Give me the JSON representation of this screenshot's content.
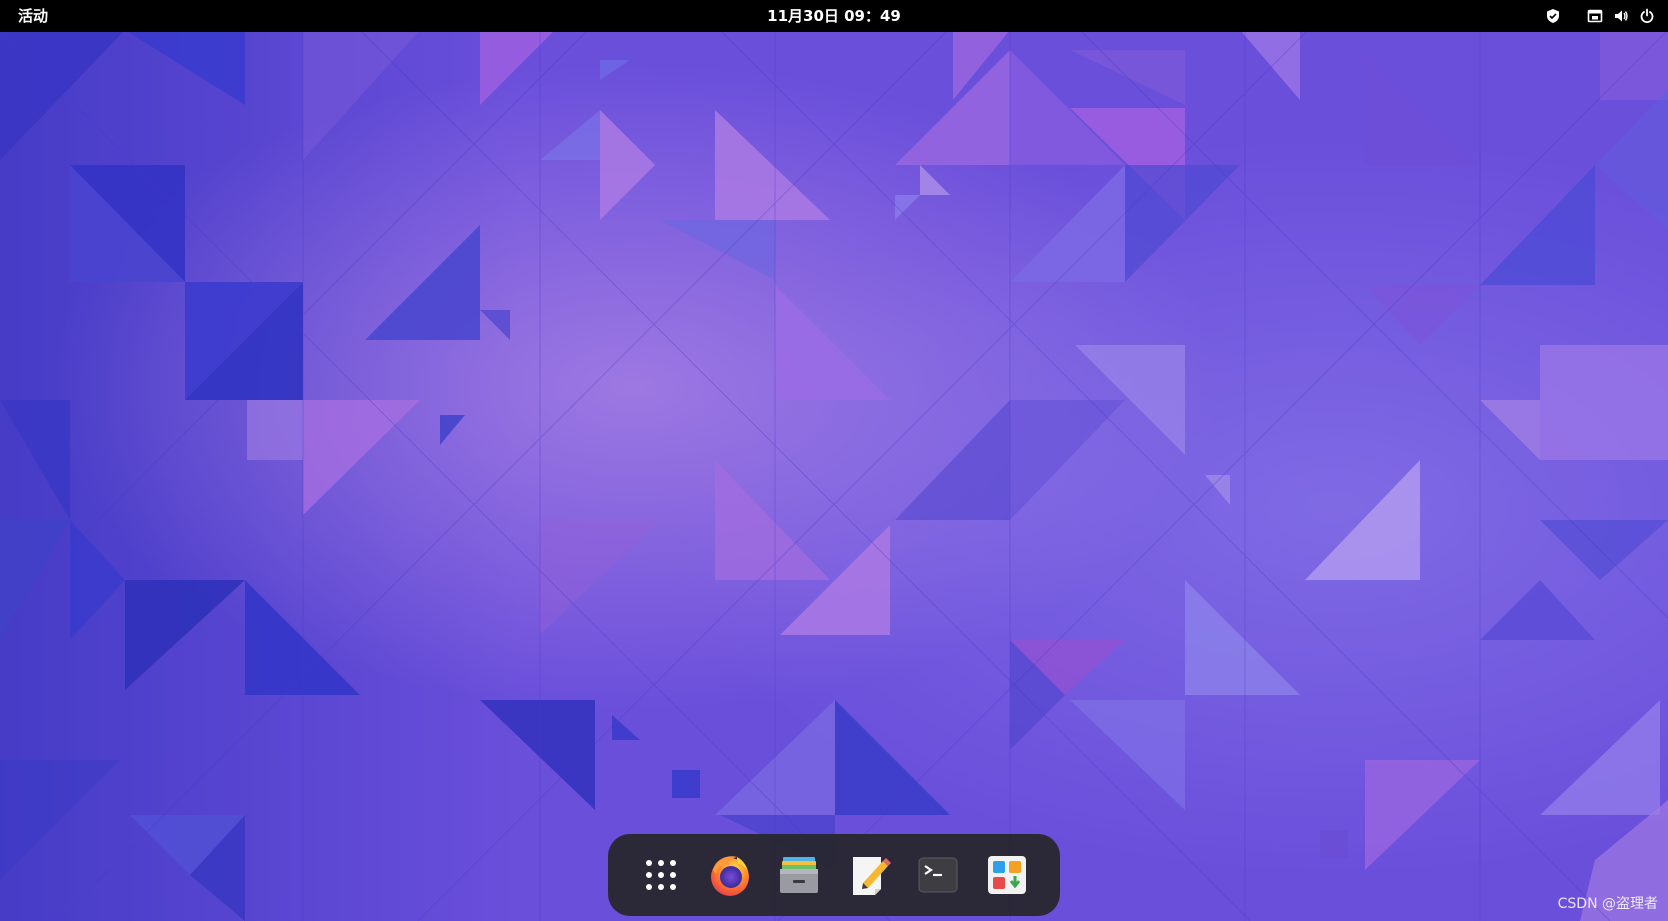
{
  "topbar": {
    "activities_label": "活动",
    "clock": "11月30日 09：49",
    "tray_icons": [
      "shield-icon",
      "network-icon",
      "volume-icon",
      "power-icon"
    ]
  },
  "dock": {
    "items": [
      {
        "icon": "app-grid-icon"
      },
      {
        "icon": "firefox-icon"
      },
      {
        "icon": "file-manager-icon"
      },
      {
        "icon": "text-editor-icon"
      },
      {
        "icon": "terminal-icon"
      },
      {
        "icon": "software-center-icon"
      }
    ]
  },
  "watermark": "CSDN @盗理者",
  "colors": {
    "topbar_bg": "#000000",
    "dock_bg": "#26262a",
    "wallpaper_base": "#6f4fd8",
    "accent_blue": "#3b3fc8",
    "accent_pink": "#b07be0"
  }
}
